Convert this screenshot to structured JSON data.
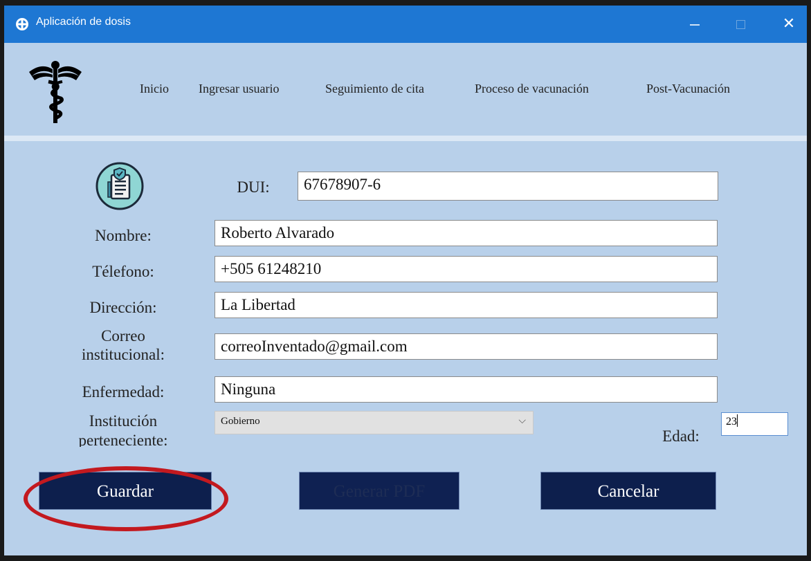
{
  "window": {
    "title": "Aplicación de dosis"
  },
  "nav": [
    "Inicio",
    "Ingresar usuario",
    "Seguimiento de cita",
    "Proceso de vacunación",
    "Post-Vacunación"
  ],
  "form": {
    "dui_label": "DUI:",
    "dui_value": "67678907-6",
    "nombre_label": "Nombre:",
    "nombre_value": "Roberto Alvarado",
    "telefono_label": "Télefono:",
    "telefono_value": "+505 61248210",
    "direccion_label": "Dirección:",
    "direccion_value": "La Libertad",
    "correo_label_1": "Correo",
    "correo_label_2": "institucional:",
    "correo_value": "correoInventado@gmail.com",
    "enfermedad_label": "Enfermedad:",
    "enfermedad_value": "Ninguna",
    "institucion_label_1": "Institución",
    "institucion_label_2": "perteneciente:",
    "institucion_value": "Gobierno",
    "edad_label": "Edad:",
    "edad_value": "23"
  },
  "buttons": {
    "guardar": "Guardar",
    "generar_pdf": "Generar PDF",
    "cancelar": "Cancelar"
  },
  "colors": {
    "titlebar": "#1e77d3",
    "background": "#b8d0ea",
    "button": "#0d1f4d",
    "highlight": "#c3191f"
  }
}
